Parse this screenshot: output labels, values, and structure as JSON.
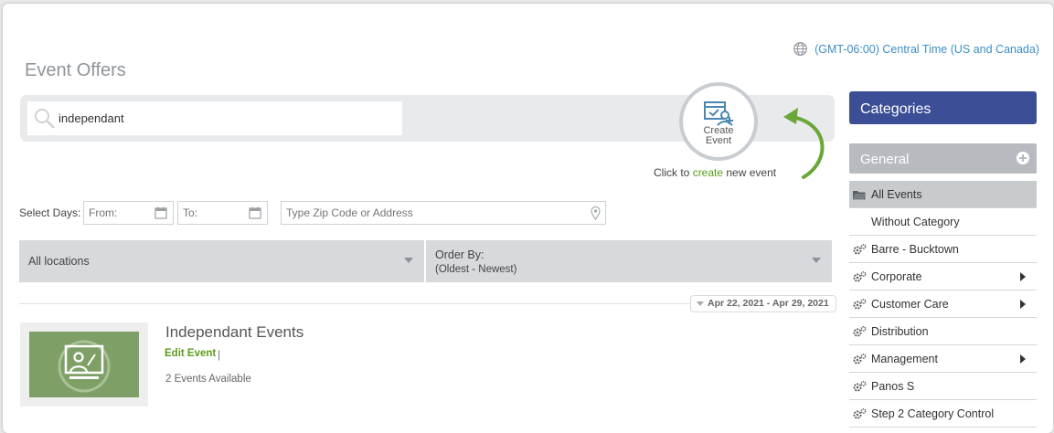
{
  "timezone": {
    "label": "(GMT-06:00) Central Time (US and Canada)"
  },
  "page": {
    "title": "Event Offers"
  },
  "search": {
    "value": "independant"
  },
  "create": {
    "button_label": "Create Event",
    "hint_prefix": "Click to ",
    "hint_link": "create",
    "hint_suffix": " new event",
    "accent_color": "#5b9b1e"
  },
  "filters": {
    "select_days_label": "Select Days:",
    "from_placeholder": "From:",
    "to_placeholder": "To:",
    "zip_placeholder": "Type Zip Code or Address"
  },
  "location_dropdown": {
    "value": "All locations"
  },
  "order_dropdown": {
    "label": "Order By:",
    "value": "(Oldest - Newest)"
  },
  "date_range": {
    "label": "Apr 22, 2021 - Apr 29, 2021"
  },
  "events": [
    {
      "title": "Independant Events",
      "edit_label": "Edit Event",
      "separator": "|",
      "count_label": "2 Events Available"
    }
  ],
  "categories": {
    "header": "Categories",
    "group": "General",
    "header_color": "#3c4e96",
    "items": [
      {
        "label": "All Events",
        "icon": "folder-icon",
        "active": true,
        "has_children": false
      },
      {
        "label": "Without Category",
        "icon": "",
        "active": false,
        "has_children": false
      },
      {
        "label": "Barre - Bucktown",
        "icon": "gears-icon",
        "active": false,
        "has_children": false
      },
      {
        "label": "Corporate",
        "icon": "gears-icon",
        "active": false,
        "has_children": true
      },
      {
        "label": "Customer Care",
        "icon": "gears-icon",
        "active": false,
        "has_children": true
      },
      {
        "label": "Distribution",
        "icon": "gears-icon",
        "active": false,
        "has_children": false
      },
      {
        "label": "Management",
        "icon": "gears-icon",
        "active": false,
        "has_children": true
      },
      {
        "label": "Panos S",
        "icon": "gears-icon",
        "active": false,
        "has_children": false
      },
      {
        "label": "Step 2 Category Control",
        "icon": "gears-icon",
        "active": false,
        "has_children": false
      }
    ]
  }
}
